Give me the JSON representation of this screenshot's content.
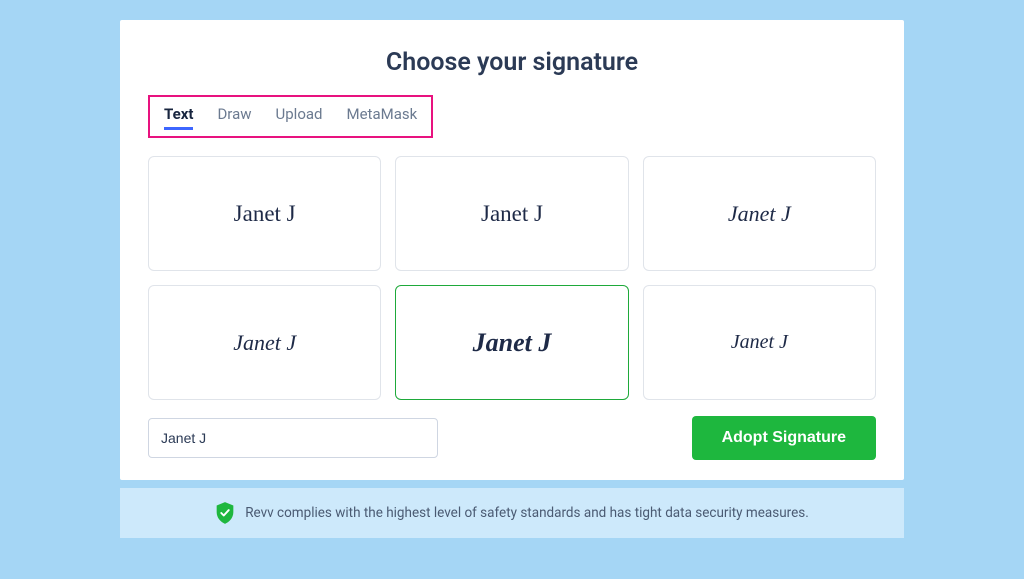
{
  "header": {
    "title": "Choose your signature"
  },
  "tabs": {
    "items": [
      {
        "label": "Text",
        "active": true
      },
      {
        "label": "Draw",
        "active": false
      },
      {
        "label": "Upload",
        "active": false
      },
      {
        "label": "MetaMask",
        "active": false
      }
    ]
  },
  "signature_text": "Janet J",
  "options": {
    "selected_index": 4
  },
  "input": {
    "value": "Janet J"
  },
  "actions": {
    "adopt_label": "Adopt Signature"
  },
  "footer": {
    "message": "Revv complies with the highest level of safety standards and has tight data security measures."
  }
}
